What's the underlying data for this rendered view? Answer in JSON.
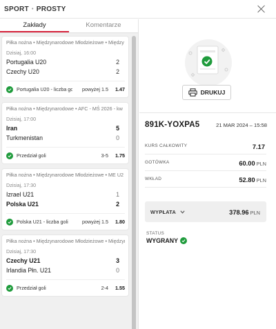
{
  "header": {
    "type": "SPORT",
    "separator": "•",
    "mode": "PROSTY"
  },
  "tabs": [
    {
      "label": "Zakłady",
      "active": true
    },
    {
      "label": "Komentarze",
      "active": false
    }
  ],
  "bets": [
    {
      "league": "Piłka nożna • Międzynarodowe Młodzieżowe • Między",
      "time": "Dzisiaj, 16:00",
      "teams": [
        {
          "name": "Portugalia U20",
          "score": "2"
        },
        {
          "name": "Czechy U20",
          "score": "2"
        }
      ],
      "pick": {
        "name": "Portugalia U20 - liczba goli",
        "line": "powyżej 1.5",
        "odds": "1.47"
      }
    },
    {
      "league": "Piłka nożna • Międzynarodowe • AFC - MŚ 2026 - kw",
      "time": "Dzisiaj, 17:00",
      "teams": [
        {
          "name": "Iran",
          "score": "5"
        },
        {
          "name": "Turkmenistan",
          "score": "0"
        }
      ],
      "pick": {
        "name": "Przedział goli",
        "line": "3-5",
        "odds": "1.75"
      }
    },
    {
      "league": "Piłka nożna • Międzynarodowe Młodzieżowe • ME U2",
      "time": "Dzisiaj, 17:30",
      "teams": [
        {
          "name": "Izrael U21",
          "score": "1"
        },
        {
          "name": "Polska U21",
          "score": "2"
        }
      ],
      "pick": {
        "name": "Polska U21 - liczba goli",
        "line": "powyżej 1.5",
        "odds": "1.80"
      }
    },
    {
      "league": "Piłka nożna • Międzynarodowe Młodzieżowe • Międzyr",
      "time": "Dzisiaj, 17:30",
      "teams": [
        {
          "name": "Czechy U21",
          "score": "3"
        },
        {
          "name": "Irlandia Płn. U21",
          "score": "0"
        }
      ],
      "pick": {
        "name": "Przedział goli",
        "line": "2-4",
        "odds": "1.55"
      }
    }
  ],
  "print_label": "DRUKUJ",
  "ticket": {
    "id": "891K-YOXPA5",
    "date": "21 MAR 2024 – 15:58",
    "rows": [
      {
        "label": "KURS CAŁKOWITY",
        "value": "7.17",
        "currency": ""
      },
      {
        "label": "GOTÓWKA",
        "value": "60.00",
        "currency": "PLN"
      },
      {
        "label": "WKŁAD",
        "value": "52.80",
        "currency": "PLN"
      }
    ],
    "payout": {
      "label": "WYPŁATA",
      "value": "378.96",
      "currency": "PLN"
    },
    "status_label": "STATUS",
    "status_value": "WYGRANY"
  },
  "colors": {
    "accent": "#d6213a",
    "success": "#1f9b3c"
  }
}
